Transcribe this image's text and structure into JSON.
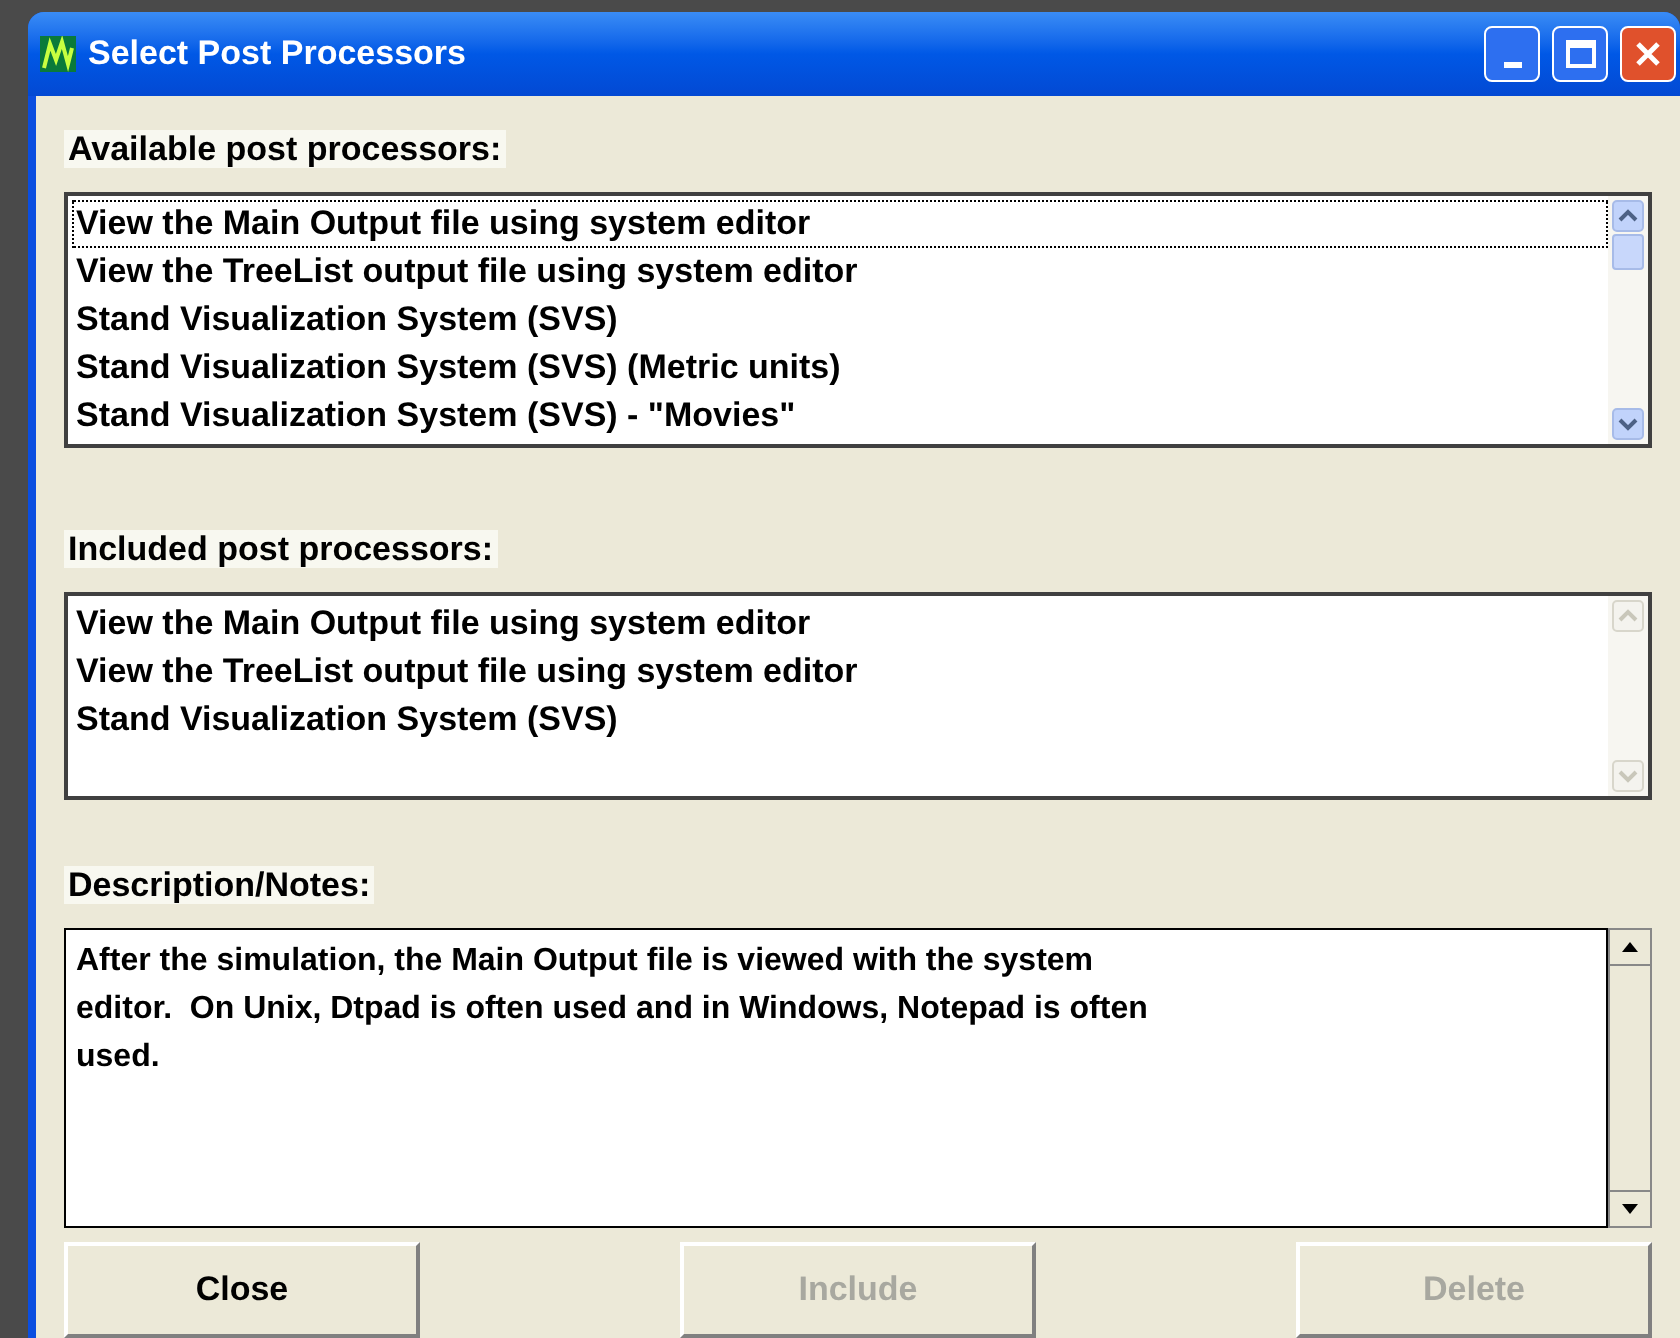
{
  "window": {
    "title": "Select Post Processors"
  },
  "available": {
    "label": "Available post processors:",
    "items": [
      {
        "text": "View the Main Output file using system editor",
        "selected": true
      },
      {
        "text": "View the TreeList output file using system editor",
        "selected": false
      },
      {
        "text": "Stand Visualization System (SVS)",
        "selected": false
      },
      {
        "text": "Stand Visualization System (SVS) (Metric units)",
        "selected": false
      },
      {
        "text": "Stand Visualization System (SVS) - \"Movies\"",
        "selected": false
      }
    ]
  },
  "included": {
    "label": "Included post processors:",
    "items": [
      {
        "text": "View the Main Output file using system editor"
      },
      {
        "text": "View the TreeList output file using system editor"
      },
      {
        "text": "Stand Visualization System (SVS)"
      }
    ]
  },
  "notes": {
    "label": "Description/Notes:",
    "lines": [
      "After the simulation, the Main Output file is viewed with the system",
      "editor.  On Unix, Dtpad is often used and in Windows, Notepad is often",
      "used."
    ]
  },
  "buttons": [
    {
      "label": "Close",
      "disabled": false
    },
    {
      "label": "Include",
      "disabled": true
    },
    {
      "label": "Delete",
      "disabled": true
    }
  ]
}
